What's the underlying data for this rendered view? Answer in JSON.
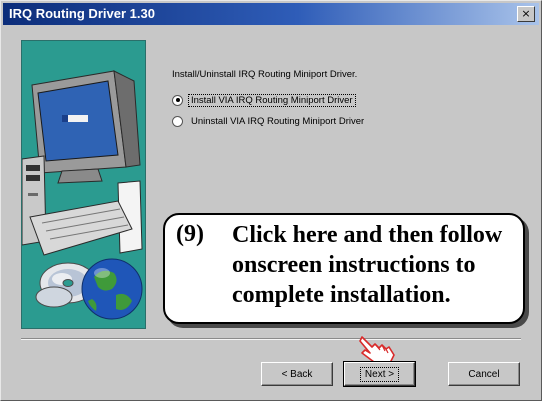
{
  "window": {
    "title": "IRQ Routing Driver 1.30",
    "close_glyph": "×"
  },
  "content": {
    "instruction": "Install/Uninstall IRQ Routing Miniport Driver.",
    "options": [
      {
        "label": "Install VIA IRQ Routing Miniport Driver",
        "selected": true
      },
      {
        "label": "Uninstall VIA IRQ Routing Miniport Driver",
        "selected": false
      }
    ]
  },
  "callout": {
    "number": "(9)",
    "lines": [
      "Click here and then follow",
      "onscreen instructions to",
      "complete installation."
    ]
  },
  "buttons": {
    "back": "< Back",
    "next": "Next >",
    "cancel": "Cancel"
  },
  "icons": {
    "computer": "computer-icon",
    "cd": "cd-icon",
    "globe": "globe-icon",
    "hand_pointer": "hand-pointer-icon"
  },
  "colors": {
    "title_start": "#0c2d7a",
    "title_end": "#a9c3ea",
    "panel": "#2b9b90",
    "dialog": "#c7c7c7",
    "pointer": "#d92a2a"
  }
}
